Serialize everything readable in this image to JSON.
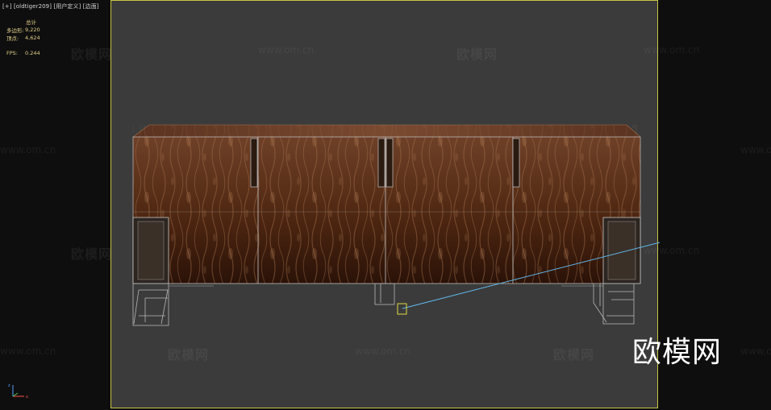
{
  "viewport": {
    "label": "[+] [oldtiger209] [用户定义] [边面]"
  },
  "stats": {
    "total_label": "总计",
    "rows": [
      {
        "key": "多边形:",
        "value": "9,220"
      },
      {
        "key": "顶点:",
        "value": "4,624"
      }
    ],
    "fps_key": "FPS:",
    "fps_value": "0.244"
  },
  "watermarks": {
    "cn": "欧模网",
    "url": "www.om.cn"
  },
  "logo": {
    "text": "欧模网"
  },
  "colors": {
    "viewport_bg": "#3b3b3b",
    "outer_bg": "#0e0e0e",
    "safe_frame": "#c9c444",
    "stats_text": "#e3d08a",
    "wood_dark": "#3a1e10",
    "wood_light": "#8a5a3a",
    "wire": "#b8b8b8",
    "selection_line": "#5fb6e8"
  },
  "icons": {
    "axis_gizmo": "axis-tripod-icon"
  }
}
